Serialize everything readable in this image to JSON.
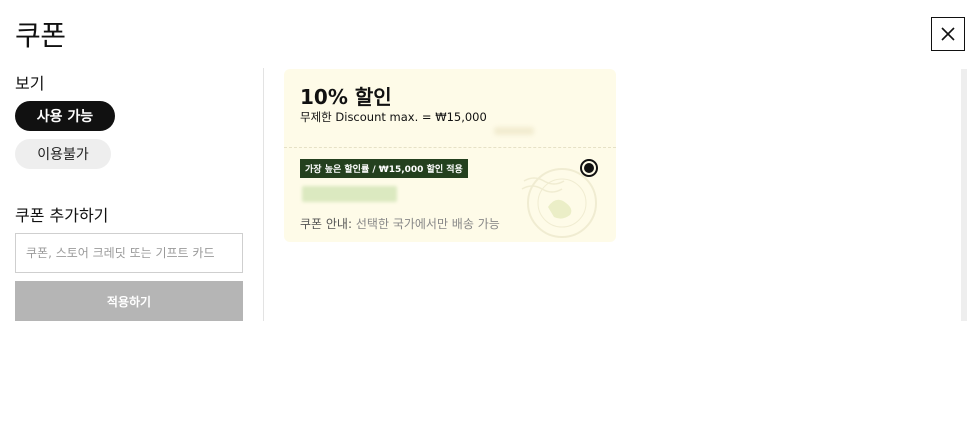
{
  "dialog": {
    "title": "쿠폰",
    "close_icon": "close-icon"
  },
  "filter": {
    "label": "보기",
    "options": [
      {
        "label": "사용 가능",
        "active": true
      },
      {
        "label": "이용불가",
        "active": false
      }
    ]
  },
  "add_coupon": {
    "label": "쿠폰 추가하기",
    "placeholder": "쿠폰, 스토어 크레딧 또는 기프트 카드",
    "value": "",
    "apply_label": "적용하기"
  },
  "coupons": [
    {
      "title": "10% 할인",
      "subtitle": "무제한 Discount max. = ₩15,000",
      "badge": "가장 높은 할인률 / ₩15,000 할인 적용",
      "notice_label": "쿠폰 안내:",
      "notice_text": "선택한 국가에서만 배송 가능",
      "selected": true
    }
  ],
  "colors": {
    "coupon_bg": "#fefbe8",
    "badge_bg": "#24401e",
    "active_pill_bg": "#111111",
    "inactive_pill_bg": "#eeeeee",
    "apply_disabled_bg": "#b5b5b5"
  }
}
